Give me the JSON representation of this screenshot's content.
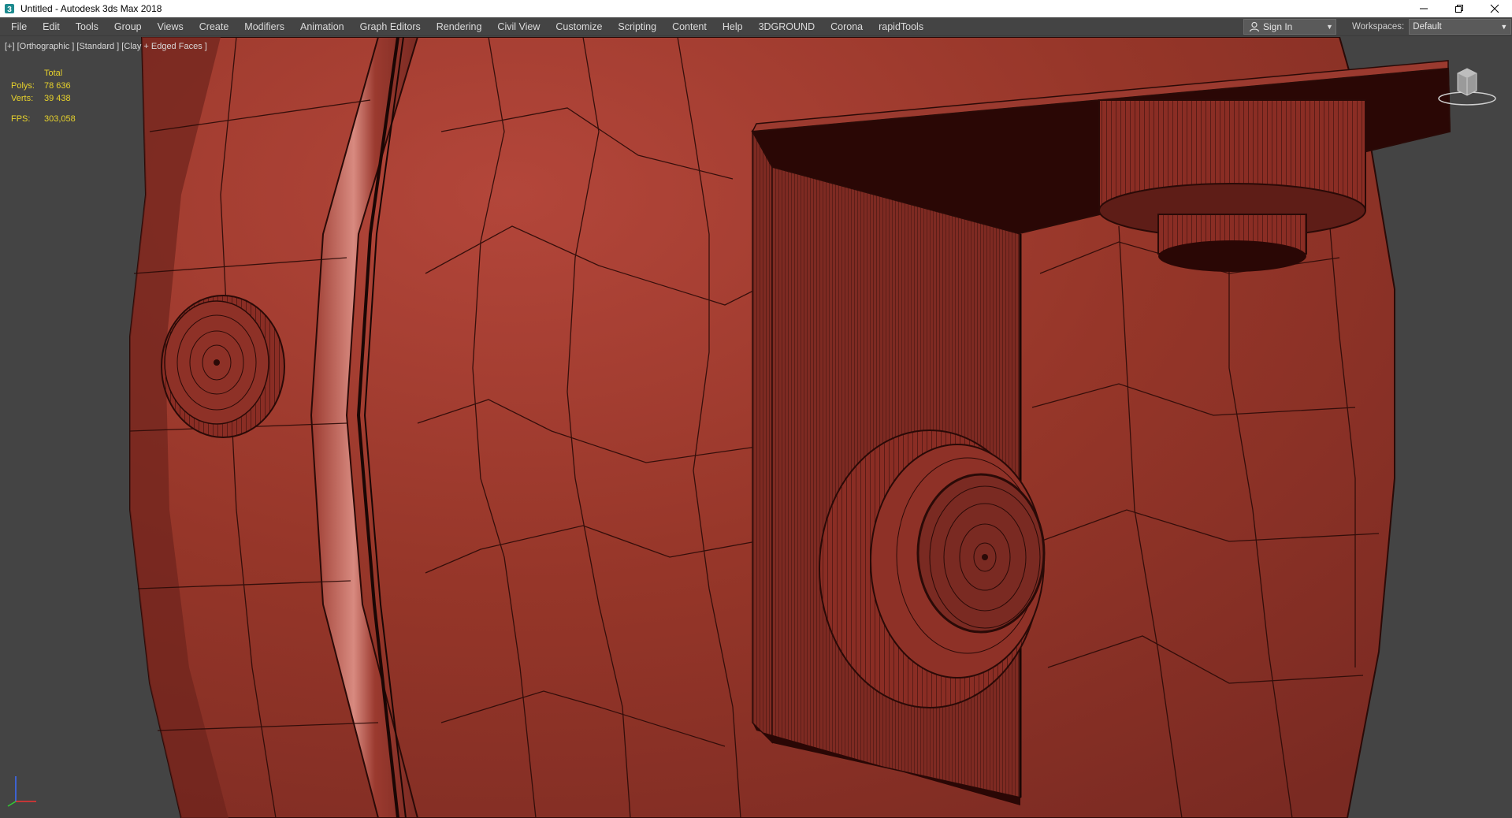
{
  "window": {
    "title": "Untitled - Autodesk 3ds Max 2018",
    "icons": {
      "app": "3dsmax-app-icon",
      "minimize": "minimize-icon",
      "restore": "restore-icon",
      "close": "close-icon"
    }
  },
  "menu": {
    "items": [
      "File",
      "Edit",
      "Tools",
      "Group",
      "Views",
      "Create",
      "Modifiers",
      "Animation",
      "Graph Editors",
      "Rendering",
      "Civil View",
      "Customize",
      "Scripting",
      "Content",
      "Help",
      "3DGROUND",
      "Corona",
      "rapidTools"
    ]
  },
  "account": {
    "sign_in_label": "Sign In",
    "icon": "user-icon"
  },
  "workspaces": {
    "label": "Workspaces:",
    "value": "Default"
  },
  "viewport": {
    "label": "[+] [Orthographic ] [Standard ] [Clay + Edged Faces ]",
    "stats": {
      "header": "Total",
      "polys_label": "Polys:",
      "polys_value": "78 636",
      "verts_label": "Verts:",
      "verts_value": "39 438",
      "fps_label": "FPS:",
      "fps_value": "303,058"
    },
    "colors": {
      "background": "#444444",
      "clay": "#8b2e26",
      "clay_light": "#b4473a",
      "wire": "#2a0a07",
      "stats_text": "#e7d22c"
    }
  }
}
